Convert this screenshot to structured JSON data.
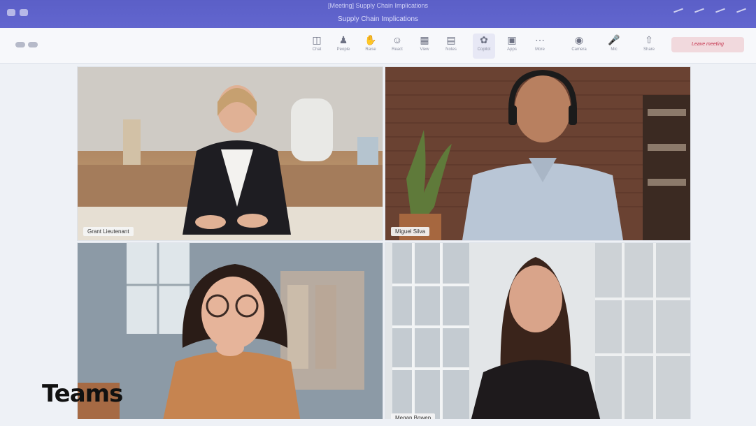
{
  "window": {
    "title_top": "[Meeting] Supply Chain Implications",
    "title": "Supply Chain Implications"
  },
  "toolbar": {
    "items": [
      {
        "label": "Chat",
        "icon": "chat-icon"
      },
      {
        "label": "People",
        "icon": "people-icon"
      },
      {
        "label": "Raise",
        "icon": "raise-hand-icon"
      },
      {
        "label": "React",
        "icon": "react-icon"
      },
      {
        "label": "View",
        "icon": "view-icon"
      },
      {
        "label": "Notes",
        "icon": "notes-icon"
      },
      {
        "label": "Copilot",
        "icon": "copilot-icon"
      },
      {
        "label": "Apps",
        "icon": "apps-icon"
      },
      {
        "label": "More",
        "icon": "more-icon"
      },
      {
        "label": "Camera",
        "icon": "camera-icon"
      },
      {
        "label": "Mic",
        "icon": "mic-icon"
      },
      {
        "label": "Share",
        "icon": "share-icon"
      }
    ],
    "leave_label": "Leave meeting"
  },
  "participants": [
    {
      "name": "Grant Lieutenant"
    },
    {
      "name": "Miguel Silva"
    },
    {
      "name": ""
    },
    {
      "name": "Megan Bowen"
    }
  ],
  "overlay_label": "Teams"
}
